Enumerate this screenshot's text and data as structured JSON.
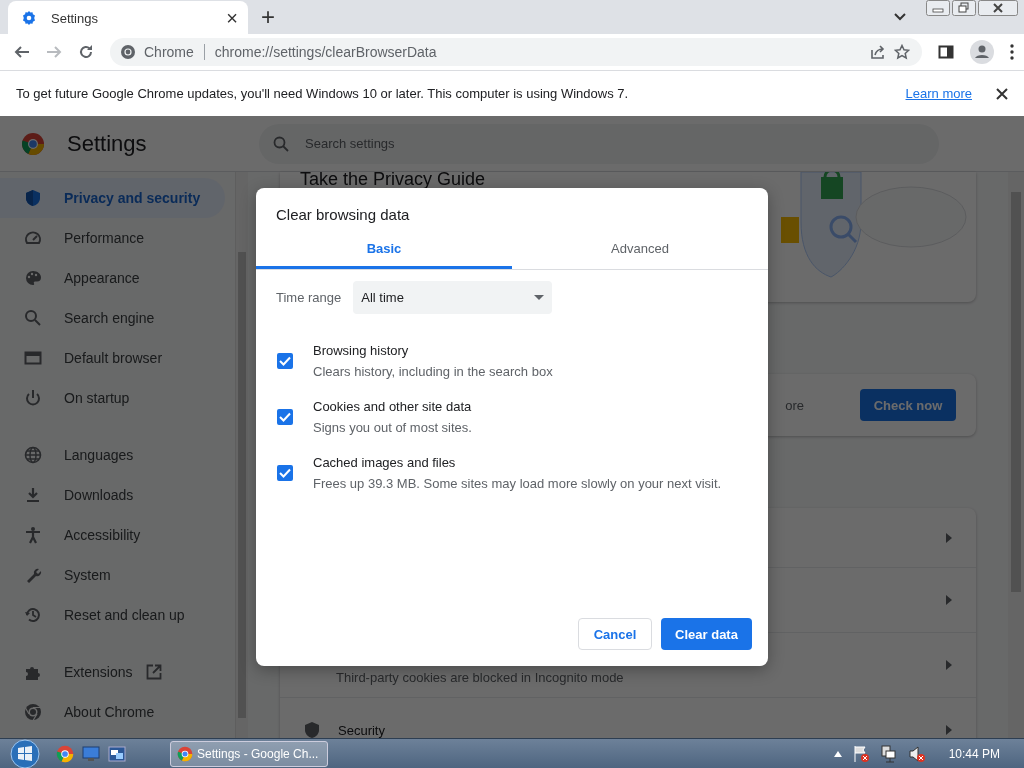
{
  "browser": {
    "tab": {
      "title": "Settings",
      "close": "×"
    },
    "new_tab": "+",
    "address": {
      "origin": "Chrome",
      "url": "chrome://settings/clearBrowserData"
    }
  },
  "infobar": {
    "message": "To get future Google Chrome updates, you'll need Windows 10 or later. This computer is using Windows 7.",
    "link": "Learn more"
  },
  "settings": {
    "title": "Settings",
    "search": {
      "placeholder": "Search settings"
    },
    "sidebar": {
      "groups": [
        {
          "items": [
            {
              "label": "Privacy and security",
              "selected": true,
              "external_link": false
            },
            {
              "label": "Performance",
              "selected": false,
              "external_link": false
            },
            {
              "label": "Appearance",
              "selected": false,
              "external_link": false
            },
            {
              "label": "Search engine",
              "selected": false,
              "external_link": false
            },
            {
              "label": "Default browser",
              "selected": false,
              "external_link": false
            },
            {
              "label": "On startup",
              "selected": false,
              "external_link": false
            }
          ]
        },
        {
          "items": [
            {
              "label": "Languages",
              "selected": false,
              "external_link": false
            },
            {
              "label": "Downloads",
              "selected": false,
              "external_link": false
            },
            {
              "label": "Accessibility",
              "selected": false,
              "external_link": false
            },
            {
              "label": "System",
              "selected": false,
              "external_link": false
            },
            {
              "label": "Reset and clean up",
              "selected": false,
              "external_link": false
            }
          ]
        },
        {
          "items": [
            {
              "label": "Extensions",
              "selected": false,
              "external_link": true
            },
            {
              "label": "About Chrome",
              "selected": false,
              "external_link": false
            }
          ]
        }
      ]
    },
    "main": {
      "privacy_guide_title": "Take the Privacy Guide",
      "safety_check": {
        "text": "ore",
        "button": "Check now"
      },
      "privacy_rows": [
        {
          "title": null,
          "description": null
        },
        {
          "title": null,
          "description": null
        },
        {
          "description": "Third-party cookies are blocked in Incognito mode"
        },
        {
          "title": "Security"
        }
      ]
    }
  },
  "dialog": {
    "title": "Clear browsing data",
    "tabs": [
      {
        "label": "Basic",
        "selected": true
      },
      {
        "label": "Advanced",
        "selected": false
      }
    ],
    "time_range": {
      "label": "Time range",
      "value": "All time"
    },
    "options": [
      {
        "title": "Browsing history",
        "description": "Clears history, including in the search box",
        "checked": true
      },
      {
        "title": "Cookies and other site data",
        "description": "Signs you out of most sites.",
        "checked": true
      },
      {
        "title": "Cached images and files",
        "description": "Frees up 39.3 MB. Some sites may load more slowly on your next visit.",
        "checked": true
      }
    ],
    "buttons": {
      "cancel": "Cancel",
      "confirm": "Clear data"
    }
  },
  "taskbar": {
    "task": "Settings - Google Ch...",
    "clock": "10:44 PM"
  }
}
